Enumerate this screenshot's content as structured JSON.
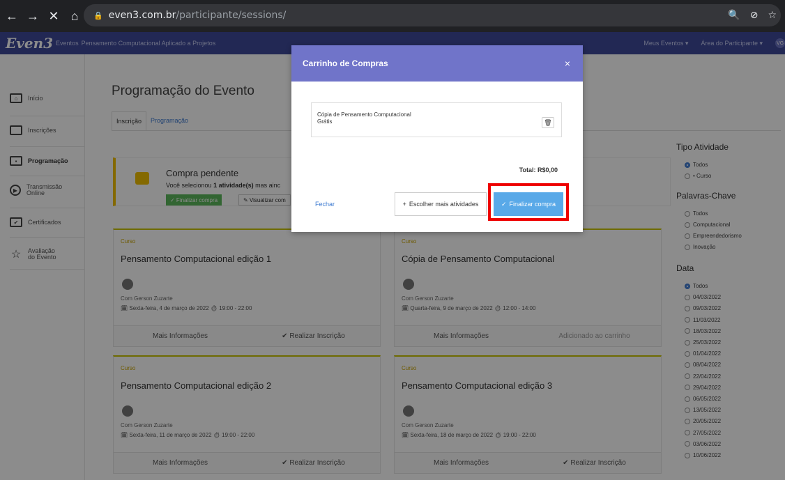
{
  "browser": {
    "url_domain": "even3.com.br",
    "url_path": "/participante/sessions/",
    "nav": {
      "back": "←",
      "forward": "→",
      "stop": "✕",
      "home": "⌂"
    },
    "right_icons": [
      "🔍",
      "⊘",
      "☆"
    ]
  },
  "header": {
    "logo": "Even3",
    "breadcrumb_events": "Eventos",
    "event_name": "Pensamento Computacional Aplicado a Projetos",
    "my_events": "Meus Eventos ▾",
    "participant_area": "Área do Participante ▾",
    "avatar_initials": "VG"
  },
  "sidebar": {
    "items": [
      {
        "label": "Início",
        "icon": "home-icon",
        "glyph": "⌂"
      },
      {
        "label": "Inscrições",
        "icon": "ticket-icon",
        "glyph": ""
      },
      {
        "label": "Programação",
        "icon": "calendar-icon",
        "glyph": "▪"
      },
      {
        "label": "Transmissão\nOnline",
        "icon": "play-icon",
        "glyph": "▶"
      },
      {
        "label": "Certificados",
        "icon": "certificate-icon",
        "glyph": "✔"
      },
      {
        "label": "Avaliação\ndo Evento",
        "icon": "star-icon",
        "glyph": "☆"
      }
    ]
  },
  "main": {
    "title": "Programação do Evento",
    "tabs": [
      "Inscrição",
      "Programação"
    ],
    "pending": {
      "title": "Compra pendente",
      "desc_prefix": "Você selecionou ",
      "desc_bold": "1 atividade(s)",
      "desc_suffix": " mas ainc",
      "btn_finalize": "✓ Finalizar compra",
      "btn_view": "✎ Visualizar com"
    },
    "cards": [
      {
        "tag": "Curso",
        "title": "Pensamento Computacional edição 1",
        "author": "Com Gerson Zuzarte",
        "when": "🗓 Sexta-feira, 4 de março de 2022   ⏱ 19:00 - 22:00",
        "more": "Mais Informações",
        "action": "✔ Realizar Inscrição"
      },
      {
        "tag": "Curso",
        "title": "Cópia de Pensamento Computacional",
        "author": "Com Gerson Zuzarte",
        "when": "🗓 Quarta-feira, 9 de março de 2022   ⏱ 12:00 - 14:00",
        "more": "Mais Informações",
        "action": "Adicionado ao carrinho"
      },
      {
        "tag": "Curso",
        "title": "Pensamento Computacional edição 2",
        "author": "Com Gerson Zuzarte",
        "when": "🗓 Sexta-feira, 11 de março de 2022   ⏱ 19:00 - 22:00",
        "more": "Mais Informações",
        "action": "✔ Realizar Inscrição"
      },
      {
        "tag": "Curso",
        "title": "Pensamento Computacional edição 3",
        "author": "Com Gerson Zuzarte",
        "when": "🗓 Sexta-feira, 18 de março de 2022   ⏱ 19:00 - 22:00",
        "more": "Mais Informações",
        "action": "✔ Realizar Inscrição"
      }
    ]
  },
  "filters": {
    "type_title": "Tipo Atividade",
    "types": [
      "Todos",
      "• Curso"
    ],
    "keywords_title": "Palavras-Chave",
    "keywords": [
      "Todos",
      "Computacional",
      "Empreendedorismo",
      "Inovação"
    ],
    "date_title": "Data",
    "dates": [
      "Todos",
      "04/03/2022",
      "09/03/2022",
      "11/03/2022",
      "18/03/2022",
      "25/03/2022",
      "01/04/2022",
      "08/04/2022",
      "22/04/2022",
      "29/04/2022",
      "06/05/2022",
      "13/05/2022",
      "20/05/2022",
      "27/05/2022",
      "03/06/2022",
      "10/06/2022"
    ]
  },
  "modal": {
    "title": "Carrinho de Compras",
    "close": "×",
    "item_name": "Cópia de Pensamento Computacional",
    "item_price": "Grátis",
    "total": "Total: R$0,00",
    "close_link": "Fechar",
    "more_btn": "Escolher mais atividades",
    "final_btn": "Finalizar compra"
  },
  "colors": {
    "header": "#3e4a9a",
    "modal_header": "#7074c9",
    "primary_btn": "#59a9e8",
    "highlight": "#ee0000"
  }
}
